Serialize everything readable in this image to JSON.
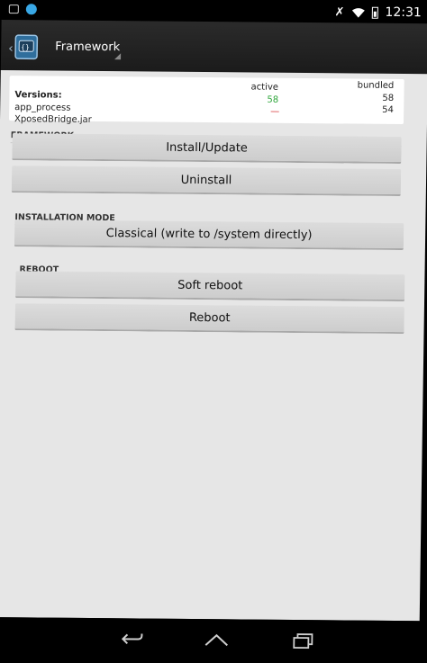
{
  "status_bar": {
    "time": "12:31",
    "icons": [
      "notification-box-icon",
      "chat-bubble-icon",
      "muted-icon",
      "wifi-icon",
      "battery-icon"
    ]
  },
  "action_bar": {
    "title": "Framework",
    "icon": "xposed-app-icon"
  },
  "versions": {
    "label": "Versions:",
    "col_active": "active",
    "col_bundled": "bundled",
    "rows": [
      {
        "name": "app_process",
        "active": "58",
        "bundled": "58"
      },
      {
        "name": "XposedBridge.jar",
        "active": "—",
        "bundled": "54"
      }
    ]
  },
  "sections": {
    "framework": {
      "title": "FRAMEWORK",
      "buttons": [
        "Install/Update",
        "Uninstall"
      ]
    },
    "installation_mode": {
      "title": "INSTALLATION MODE",
      "selected": "Classical (write to /system directly)"
    },
    "reboot": {
      "title": "REBOOT",
      "buttons": [
        "Soft reboot",
        "Reboot"
      ]
    }
  },
  "nav_bar": {
    "icons": [
      "back-icon",
      "home-icon",
      "recent-apps-icon"
    ]
  },
  "colors": {
    "active_ok": "#2ea53a",
    "active_missing": "#d8383a",
    "content_bg": "#e6e6e6",
    "action_bar_bg": "#222222"
  }
}
